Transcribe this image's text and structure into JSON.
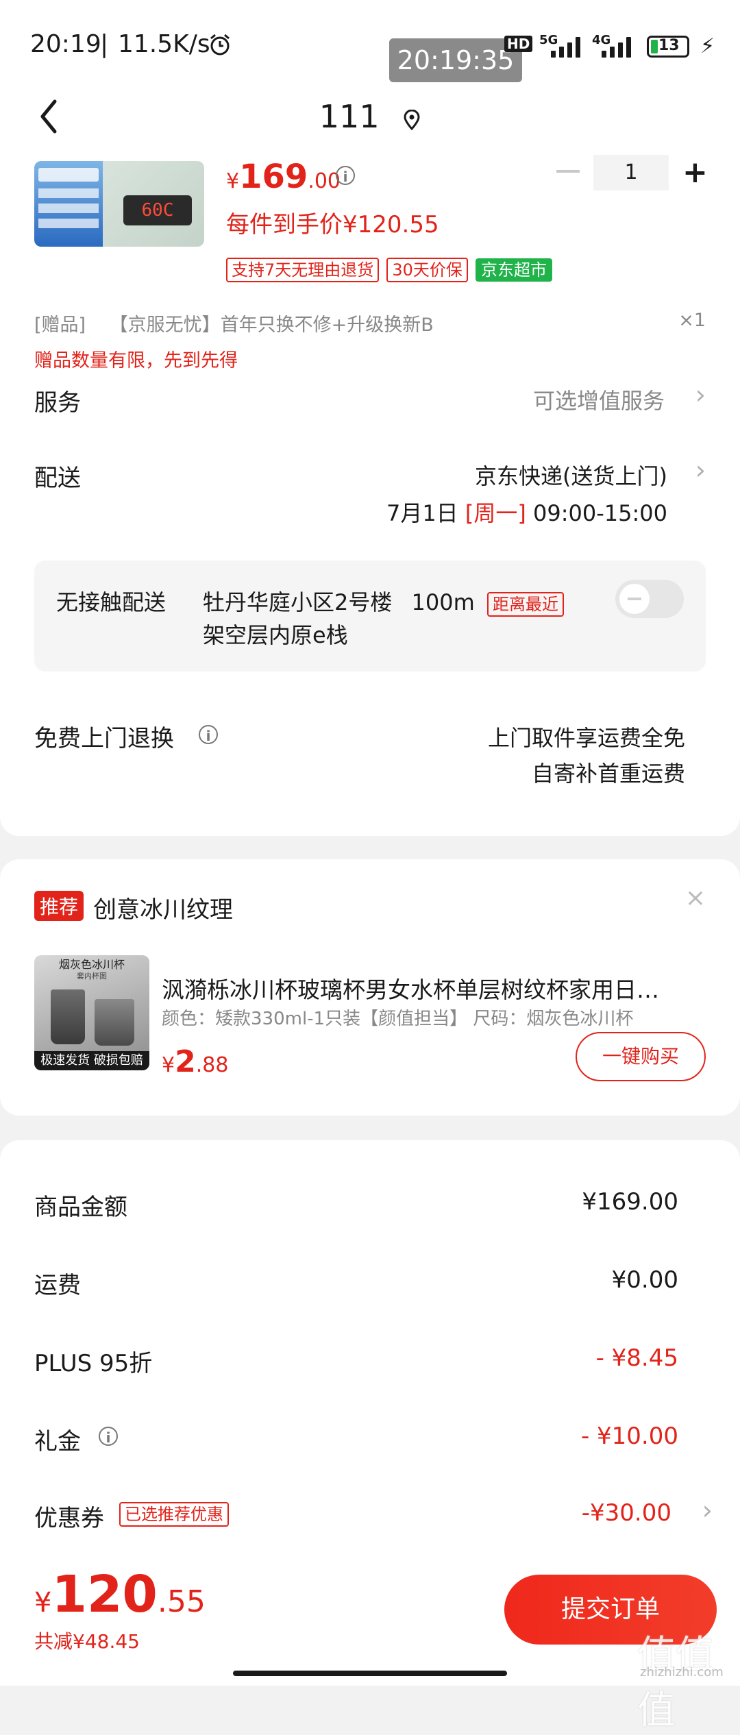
{
  "status_bar": {
    "time": "20:19",
    "speed": "11.5K/s",
    "toast_time": "20:19:35",
    "hd_label": "HD",
    "net1": "5G",
    "net2": "4G",
    "battery": "13"
  },
  "header": {
    "title": "111"
  },
  "product": {
    "currency": "¥",
    "price_int": "169",
    "price_dec": ".00",
    "final_price": "每件到手价¥120.55",
    "quantity": "1",
    "thumb_display": "60C",
    "tags": [
      "支持7天无理由退货",
      "30天价保"
    ],
    "store_tag": "京东超市"
  },
  "gift": {
    "prefix": "[赠品]",
    "name": "【京服无忧】首年只换不修+升级换新B",
    "count": "×1",
    "note": "赠品数量有限，先到先得"
  },
  "service": {
    "label": "服务",
    "value": "可选增值服务"
  },
  "delivery": {
    "label": "配送",
    "method": "京东快递(送货上门)",
    "date": "7月1日",
    "weekday": "[周一]",
    "time": "09:00-15:00"
  },
  "contactless": {
    "label": "无接触配送",
    "address_line1": "牡丹华庭小区2号楼",
    "distance": "100m",
    "badge": "距离最近",
    "address_line2": "架空层内原e栈"
  },
  "return": {
    "label": "免费上门退换",
    "line1": "上门取件享运费全免",
    "line2": "自寄补首重运费"
  },
  "recommend": {
    "badge": "推荐",
    "title": "创意冰川纹理",
    "product_name": "沨漪栎冰川杯玻璃杯男女水杯单层树纹杯家用日…",
    "spec": "颜色：矮款330ml-1只装【颜值担当】  尺码：烟灰色冰川杯",
    "price_currency": "¥",
    "price_int": "2",
    "price_dec": ".88",
    "buy_label": "一键购买",
    "thumb_title": "烟灰色冰川杯",
    "thumb_sub": "套内杯图",
    "thumb_banner1": "极速发货",
    "thumb_banner2": "破损包赔"
  },
  "summary": {
    "goods_label": "商品金额",
    "goods_value": "¥169.00",
    "shipping_label": "运费",
    "shipping_value": "¥0.00",
    "plus_label": "PLUS 95折",
    "plus_value": "- ¥8.45",
    "gift_label": "礼金",
    "gift_value": "- ¥10.00",
    "coupon_label": "优惠券",
    "coupon_tag": "已选推荐优惠",
    "coupon_value": "-¥30.00"
  },
  "footer": {
    "currency": "¥",
    "total_int": "120",
    "total_dec": ".55",
    "saved": "共减¥48.45",
    "submit_label": "提交订单"
  },
  "watermark": {
    "text": "值值值",
    "sub": "zhizhizhi.com"
  },
  "colors": {
    "accent_red": "#e2231a",
    "green": "#1fb34a",
    "button_start": "#f0281c",
    "button_end": "#f23d2a"
  }
}
